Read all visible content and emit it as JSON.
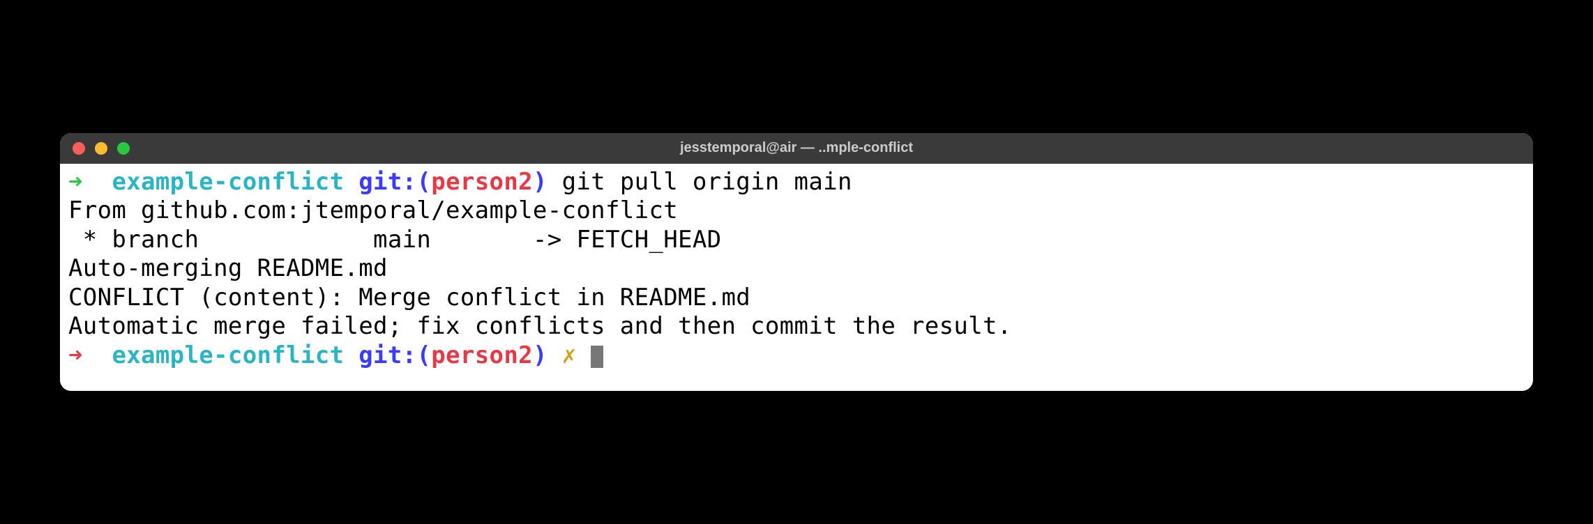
{
  "window": {
    "title": "jesstemporal@air — ..mple-conflict"
  },
  "prompt1": {
    "arrow": "➜",
    "dir": "example-conflict",
    "git_label": "git:(",
    "branch": "person2",
    "git_close": ")",
    "command": "git pull origin main"
  },
  "output": {
    "line1": "From github.com:jtemporal/example-conflict",
    "line2": " * branch            main       -> FETCH_HEAD",
    "line3": "Auto-merging README.md",
    "line4": "CONFLICT (content): Merge conflict in README.md",
    "line5": "Automatic merge failed; fix conflicts and then commit the result."
  },
  "prompt2": {
    "arrow": "➜",
    "dir": "example-conflict",
    "git_label": "git:(",
    "branch": "person2",
    "git_close": ")",
    "dirty": "✗"
  }
}
